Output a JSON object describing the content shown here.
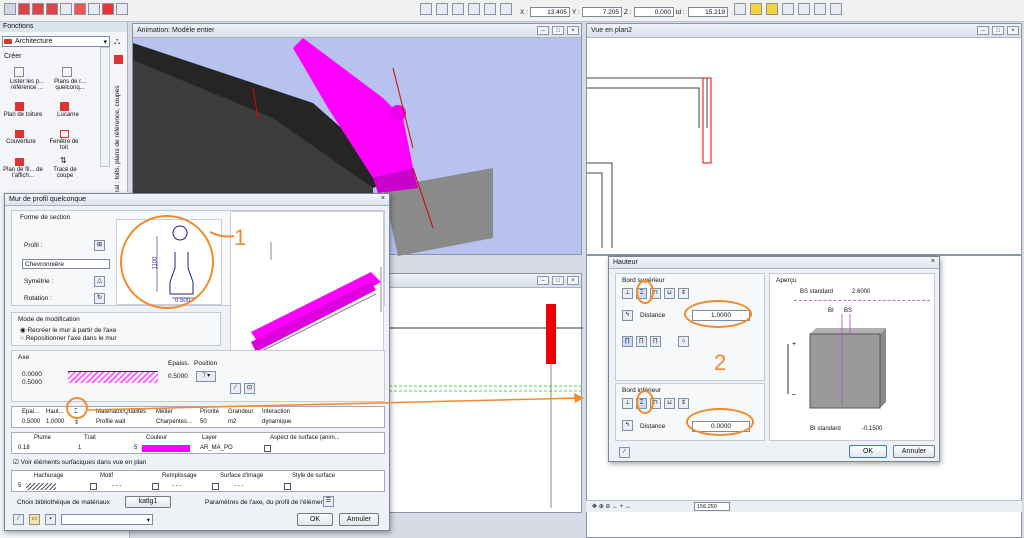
{
  "toolbar": {
    "x_label": "X :",
    "x_value": "13.405",
    "y_label": "Y :",
    "y_value": "7.205",
    "z_label": "Z :",
    "z_value": "0.000",
    "id_label": "ld :",
    "id_value": "15.219"
  },
  "functions_panel": {
    "title": "Fonctions",
    "dropdown": "Architecture",
    "section": "Créer",
    "items": [
      {
        "label": "Lister les p... référence ..."
      },
      {
        "label": "Plans de r... quelconq..."
      },
      {
        "label": "Plan de toiture"
      },
      {
        "label": "Lucarne"
      },
      {
        "label": "Couverture"
      },
      {
        "label": "Fenêtre de toit"
      },
      {
        "label": "Plan de fil... de l'affich..."
      },
      {
        "label": "Tracé de coupe"
      }
    ],
    "vertical_tab": "Général : toits, plans de référence, coupes"
  },
  "win_anim": {
    "title": "Animation: Modèle entier"
  },
  "win_plan": {
    "title": "Vue en plan2"
  },
  "dlg_mur": {
    "title": "Mur de profil quelconque",
    "forme_section": "Forme de section",
    "profil": "Profil :",
    "profil_name": "Chevronnière",
    "symetrie": "Symétrie :",
    "rotation": "Rotation :",
    "dim_height": "1100",
    "dim_width": "0.500",
    "mode_modification": "Mode de modification",
    "radio1": "Recréer le mur à partir de l'axe",
    "radio2": "Repositionner l'axe dans le mur",
    "axe": "Axe",
    "axe_val1": "0.0000",
    "axe_val2": "0.5000",
    "epaiss_label": "Epaiss.",
    "position_label": "Position",
    "epaiss_val": "0.5000",
    "table_headers": [
      "Epai...",
      "Haut...",
      "",
      "Matériaux/Qualités",
      "Métier",
      "Priorité",
      "Grandeur",
      "Interaction"
    ],
    "table_row": [
      "0.5000",
      "1.0000",
      "",
      "Profile wall",
      "Charpentes...",
      "50",
      "m2",
      "dynamique"
    ],
    "plume_header": "Plume",
    "trait_header": "Trait",
    "couleur_header": "Couleur",
    "layer_header": "Layer",
    "aspect_header": "Aspect de surface (anim...",
    "plume_val": "0.18",
    "trait_val": "1",
    "couleur_val": "5",
    "layer_val": "AR_MA_PO",
    "checkbox_label": "Voir éléments surfaciques dans vue en plan",
    "hachurage": "Hachurage",
    "motif": "Motif",
    "remplissage": "Remplissage",
    "surface_image": "Surface d'image",
    "style_surface": "Style de surface",
    "hach_val": "5",
    "dashes": "- - -",
    "choix_biblio": "Choix bibliothèque de matériaux",
    "katlg": "katlg1",
    "parametres": "Paramètres de l'axe, du profil de l'élément :",
    "ok": "OK",
    "annuler": "Annuler"
  },
  "dlg_hauteur": {
    "title": "Hauteur",
    "bord_sup": "Bord supérieur",
    "bord_inf": "Bord inférieur",
    "distance": "Distance",
    "distance_sup": "1.0000",
    "distance_inf": "0.0000",
    "apercu": "Aperçu",
    "bs_standard": "BS standard",
    "bs_standard_val": "2.6000",
    "bi": "BI",
    "bs": "BS",
    "bi_standard": "BI standard",
    "bi_standard_val": "-0.1500",
    "ok": "OK",
    "annuler": "Annuler"
  },
  "annotations": {
    "one": "1",
    "two": "2"
  },
  "statusbar": {
    "zoom": "156.250"
  },
  "colors": {
    "magenta": "#ff00ff",
    "orange": "#f08a2a",
    "red": "#e00000"
  }
}
